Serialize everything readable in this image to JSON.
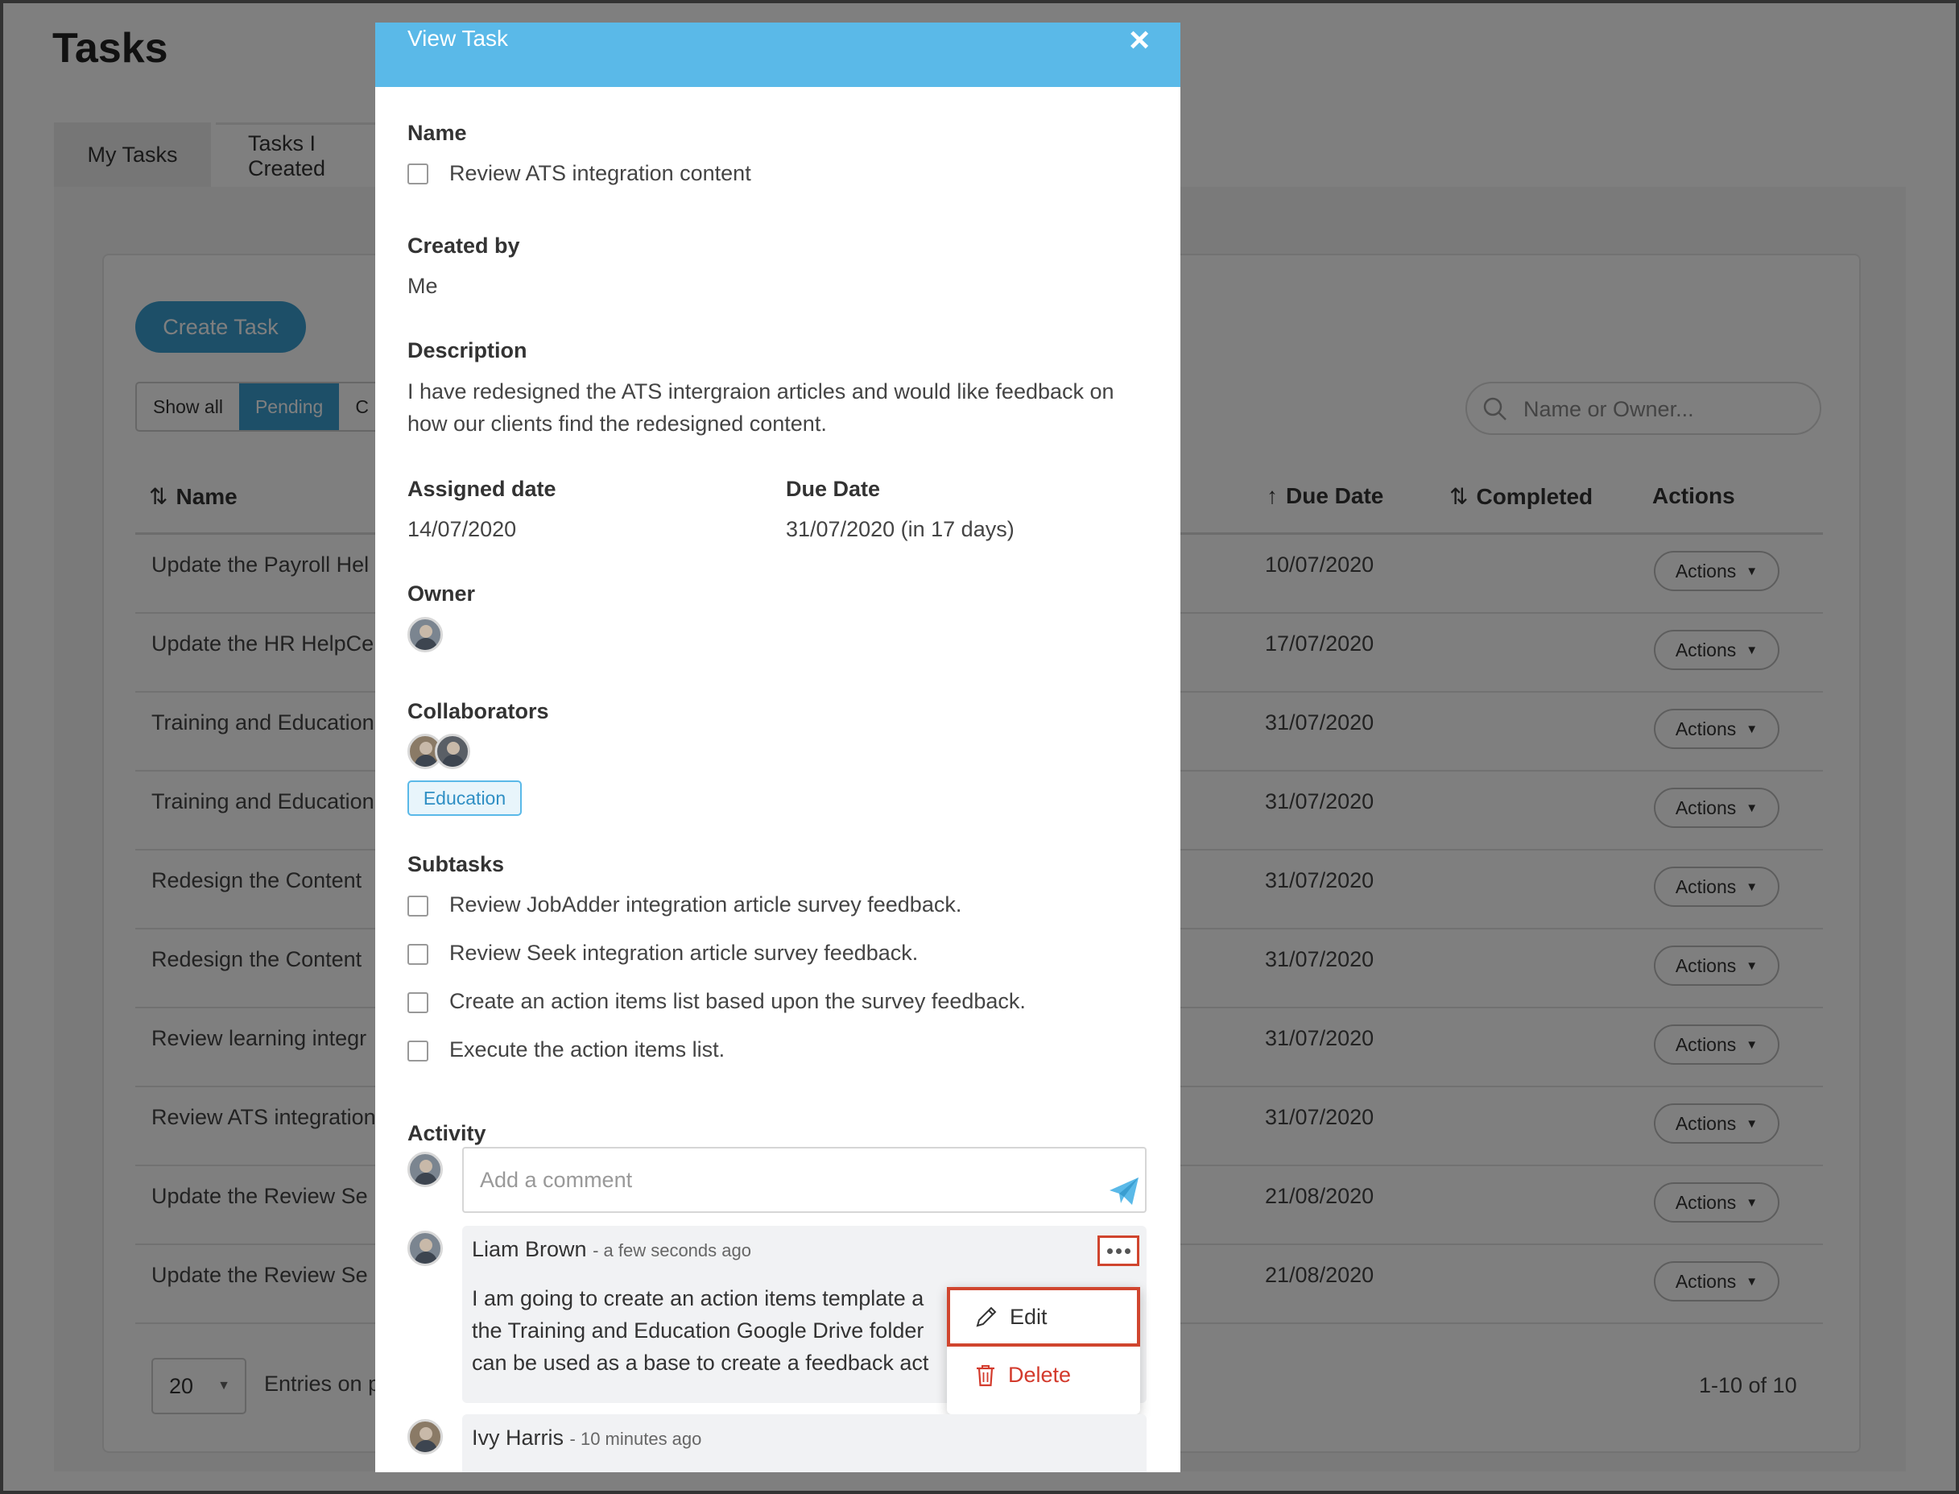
{
  "page": {
    "title": "Tasks",
    "tabs": [
      "My Tasks",
      "Tasks I Created"
    ],
    "create_button": "Create Task",
    "filters": [
      "Show all",
      "Pending",
      "C"
    ],
    "search_placeholder": "Name or Owner...",
    "columns": {
      "name": "Name",
      "due_date": "Due Date",
      "completed": "Completed",
      "actions": "Actions"
    },
    "rows": [
      {
        "name": "Update the Payroll Hel",
        "due_date": "10/07/2020",
        "action": "Actions"
      },
      {
        "name": "Update the HR HelpCe",
        "due_date": "17/07/2020",
        "action": "Actions"
      },
      {
        "name": "Training and Education",
        "due_date": "31/07/2020",
        "action": "Actions"
      },
      {
        "name": "Training and Education",
        "due_date": "31/07/2020",
        "action": "Actions"
      },
      {
        "name": "Redesign the Content",
        "due_date": "31/07/2020",
        "action": "Actions"
      },
      {
        "name": "Redesign the Content",
        "due_date": "31/07/2020",
        "action": "Actions"
      },
      {
        "name": "Review learning integr",
        "due_date": "31/07/2020",
        "action": "Actions"
      },
      {
        "name": "Review ATS integration",
        "due_date": "31/07/2020",
        "action": "Actions"
      },
      {
        "name": "Update the Review Se",
        "due_date": "21/08/2020",
        "action": "Actions"
      },
      {
        "name": "Update the Review Se",
        "due_date": "21/08/2020",
        "action": "Actions"
      }
    ],
    "entries_value": "20",
    "entries_label": "Entries on p",
    "pagination": "1-10 of 10"
  },
  "modal": {
    "title": "View Task",
    "name_label": "Name",
    "name_value": "Review ATS integration content",
    "created_by_label": "Created by",
    "created_by_value": "Me",
    "description_label": "Description",
    "description_value": "I have redesigned the ATS intergraion articles and would like feedback on how our clients find the redesigned content.",
    "assigned_label": "Assigned date",
    "assigned_value": "14/07/2020",
    "due_label": "Due Date",
    "due_value": "31/07/2020 (in 17 days)",
    "owner_label": "Owner",
    "collaborators_label": "Collaborators",
    "collaborator_tag": "Education",
    "subtasks_label": "Subtasks",
    "subtasks": [
      "Review JobAdder integration article survey feedback.",
      "Review Seek integration article survey feedback.",
      "Create an action items list based upon the survey feedback.",
      "Execute the action items list."
    ],
    "activity_label": "Activity",
    "comment_placeholder": "Add a comment",
    "comments": [
      {
        "author": "Liam Brown",
        "time": "- a few seconds ago",
        "lines": [
          "I am going to create an action items template a",
          "the Training and Education Google Drive folder",
          "can be used as a base to create a feedback act"
        ]
      },
      {
        "author": "Ivy Harris",
        "time": "- 10 minutes ago"
      }
    ],
    "menu": {
      "edit": "Edit",
      "delete": "Delete"
    }
  },
  "colors": {
    "header": "#5ab9e8",
    "primary": "#3a9ed1",
    "highlight": "#d0452e",
    "danger": "#d33a2c"
  },
  "icons": [
    "close-icon",
    "search-icon",
    "sort-icon",
    "sort-up-icon",
    "send-icon",
    "more-icon",
    "pencil-icon",
    "trash-icon",
    "chevron-down-icon"
  ]
}
